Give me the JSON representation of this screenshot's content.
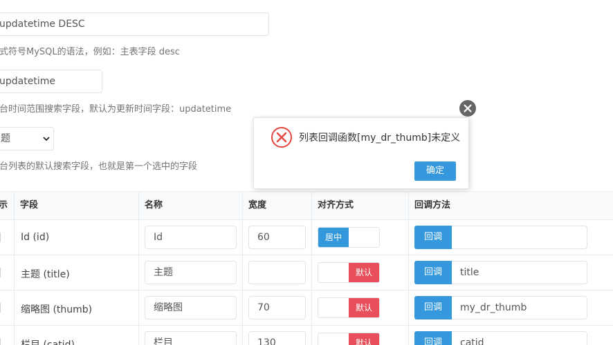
{
  "form": {
    "order_value": "updatetime DESC",
    "order_help": "格式符号MySQL的语法，例如：主表字段 desc",
    "time_value": "updatetime",
    "time_help": "后台时间范围搜索字段，默认为更新时间字段：updatetime",
    "search_select": "主题",
    "search_help": "后台列表的默认搜索字段，也就是第一个选中的字段"
  },
  "table": {
    "headers": [
      "显示",
      "字段",
      "名称",
      "宽度",
      "对齐方式",
      "回调方法"
    ],
    "rows": [
      {
        "field": "Id (id)",
        "name": "Id",
        "width": "60",
        "align": "居中",
        "align_state": "on",
        "callback": ""
      },
      {
        "field": "主题 (title)",
        "name": "主题",
        "width": "",
        "align": "默认",
        "align_state": "off",
        "callback": "title"
      },
      {
        "field": "缩略图 (thumb)",
        "name": "缩略图",
        "width": "70",
        "align": "默认",
        "align_state": "off",
        "callback": "my_dr_thumb"
      },
      {
        "field": "栏目 (catid)",
        "name": "栏目",
        "width": "130",
        "align": "默认",
        "align_state": "off",
        "callback": "catid"
      }
    ],
    "callback_button": "回调"
  },
  "dialog": {
    "message": "列表回调函数[my_dr_thumb]未定义",
    "ok_label": "确定",
    "icon": "error-circle-icon",
    "close_icon": "close-icon"
  },
  "colors": {
    "primary": "#3598dc",
    "danger": "#e7505a",
    "error_icon": "#e2463c",
    "close_bg": "#666666"
  }
}
